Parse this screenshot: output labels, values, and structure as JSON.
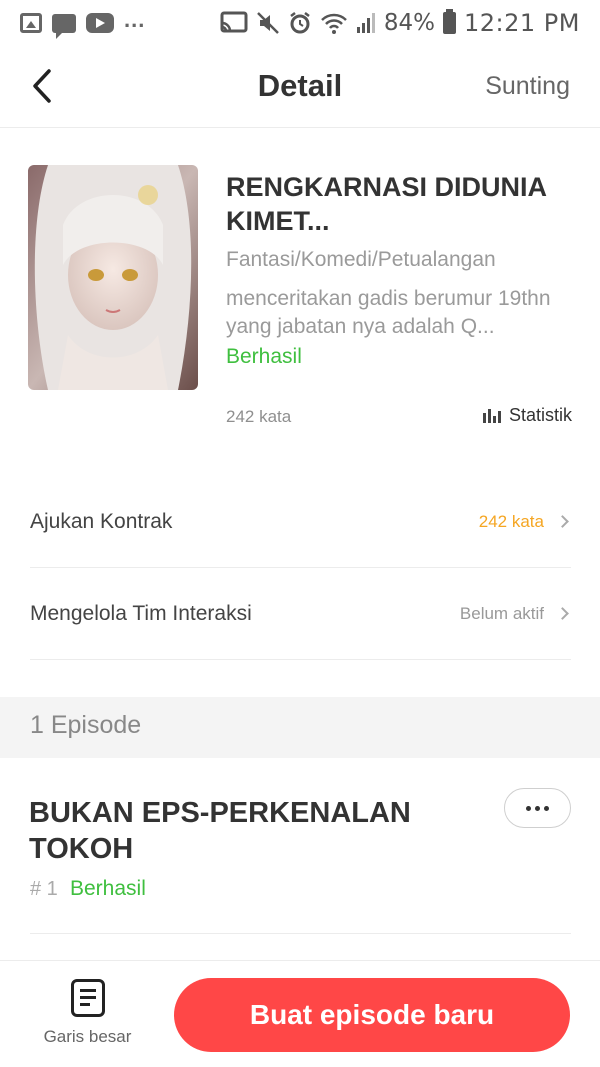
{
  "status_bar": {
    "battery": "84%",
    "time": "12:21 PM",
    "left_icons": [
      "gallery-icon",
      "chat-icon",
      "youtube-icon",
      "more-dots"
    ],
    "right_icons": [
      "cast-icon",
      "mute-icon",
      "alarm-icon",
      "wifi-icon",
      "signal-icon",
      "battery-icon"
    ]
  },
  "header": {
    "title": "Detail",
    "edit_label": "Sunting",
    "back_icon": "chevron-left-icon"
  },
  "book": {
    "title": "RENGKARNASI DIDUNIA KIMET...",
    "genre": "Fantasi/Komedi/Petualangan",
    "description": "menceritakan gadis berumur 19thn yang jabatan nya adalah Q...",
    "status": "Berhasil",
    "word_count": "242 kata",
    "stats_label": "Statistik"
  },
  "rows": [
    {
      "label": "Ajukan Kontrak",
      "value": "242 kata",
      "value_color": "#f5a623"
    },
    {
      "label": "Mengelola Tim Interaksi",
      "value": "Belum aktif",
      "value_color": "#999999"
    }
  ],
  "episodes": {
    "count_label": "1 Episode",
    "items": [
      {
        "title": "BUKAN EPS-PERKENALAN TOKOH",
        "number": "# 1",
        "status": "Berhasil"
      }
    ]
  },
  "bottom": {
    "outline_label": "Garis besar",
    "new_episode_label": "Buat episode baru"
  },
  "colors": {
    "accent_red": "#ff4747",
    "success_green": "#3fbf3f",
    "warning_orange": "#f5a623"
  }
}
